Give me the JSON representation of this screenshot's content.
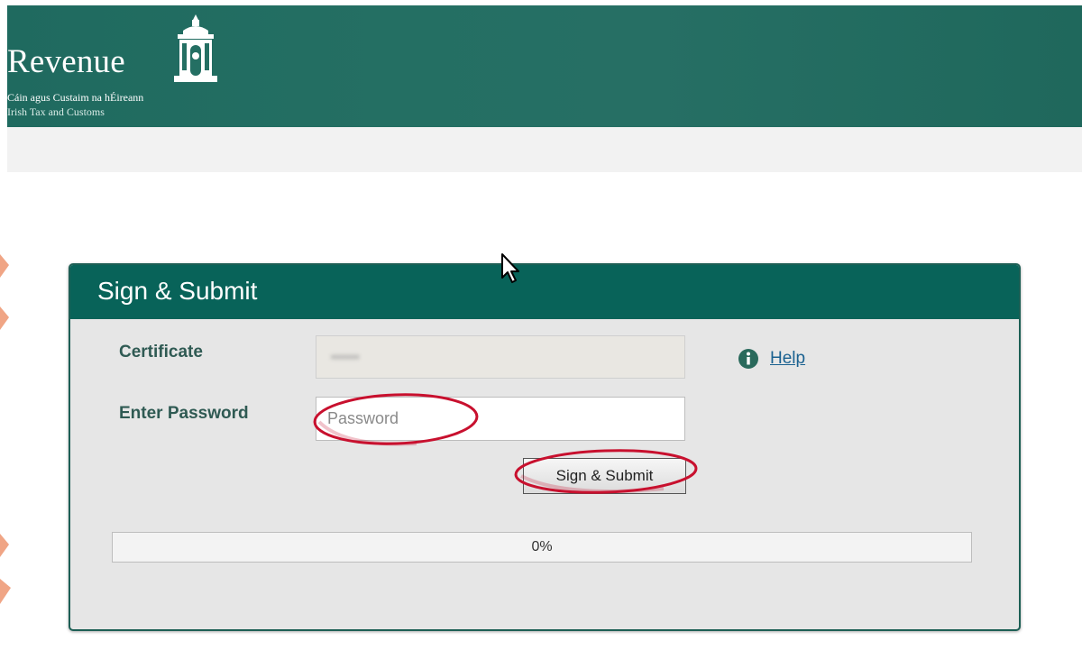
{
  "header": {
    "logo_wordmark": "Revenue",
    "logo_irish": "Cáin agus Custaim na hÉireann",
    "logo_english": "Irish Tax and Customs",
    "background": "#246f63"
  },
  "panel": {
    "title": "Sign & Submit",
    "certificate_label": "Certificate",
    "certificate_value": "••••••",
    "password_label": "Enter Password",
    "password_placeholder": "Password",
    "password_value": "",
    "help_label": "Help",
    "help_icon": "info-icon",
    "submit_label": "Sign & Submit",
    "progress": 0,
    "progress_label": "0%"
  },
  "colors": {
    "brand": "#086359",
    "link": "#1a6190",
    "annotation": "#c8102e"
  }
}
